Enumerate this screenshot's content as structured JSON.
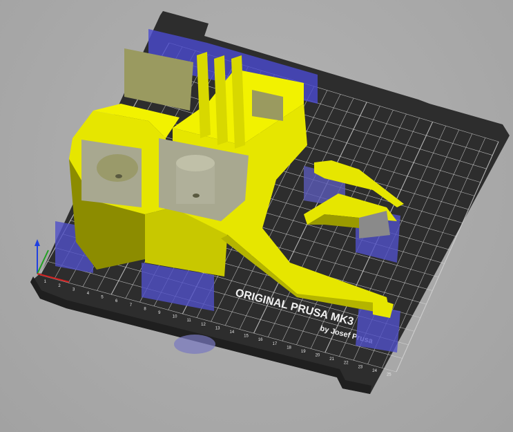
{
  "viewport": {
    "type": "3d-plater-view"
  },
  "bed": {
    "logo_line1": "ORIGINAL PRUSA MK3",
    "logo_line2": "by Josef Prusa",
    "axis_ticks": [
      "1",
      "2",
      "3",
      "4",
      "5",
      "6",
      "7",
      "8",
      "9",
      "10",
      "11",
      "12",
      "13",
      "14",
      "15",
      "16",
      "17",
      "18",
      "19",
      "20",
      "21",
      "22",
      "23",
      "24",
      "25"
    ]
  },
  "colors": {
    "background": "#a9a9a9",
    "bed": "#2b2b2b",
    "grid": "#d0d0d0",
    "part": "#e6e600",
    "part_shade": "#8c8c00",
    "selection": "#4040d0",
    "support": "#7a7a96"
  },
  "axes": {
    "x_color": "#d02020",
    "y_color": "#20a020",
    "z_color": "#2040e0"
  }
}
